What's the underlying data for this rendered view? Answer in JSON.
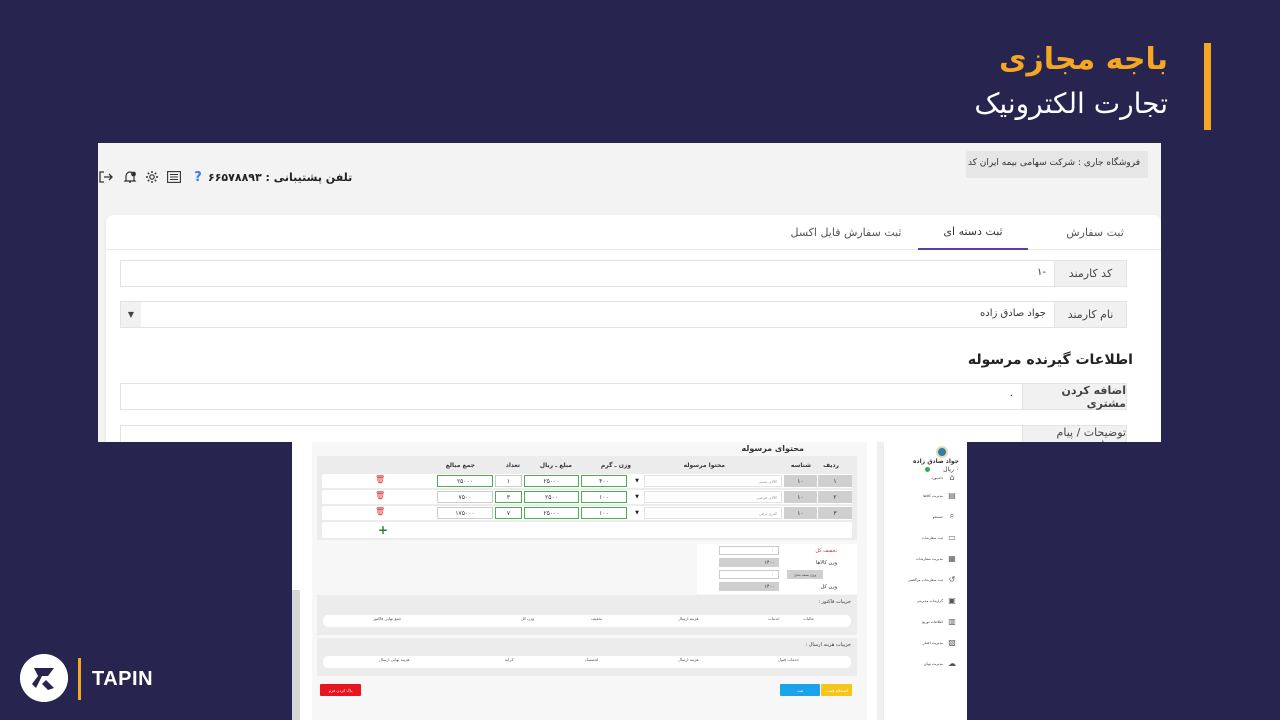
{
  "slide": {
    "title": "باجه مجازی",
    "subtitle": "تجارت الکترونیک",
    "accent_color": "#f5a623",
    "background_color": "#27254f"
  },
  "brand": {
    "name": "TAPIN",
    "logo_icon": "tapin-logo"
  },
  "topbar": {
    "store_label": "فروشگاه جاری : شرکت سهامی بیمه ایران کد۳۱۰۰",
    "support_phone": "تلفن پشتیبانی : ۶۶۵۷۸۸۹۳",
    "icons": [
      "logout-icon",
      "bell-icon",
      "gear-icon",
      "list-icon",
      "help-icon"
    ]
  },
  "tabs": [
    {
      "label": "ثبت سفارش",
      "active": false
    },
    {
      "label": "ثبت دسته ای",
      "active": true
    },
    {
      "label": "ثبت سفارش فایل اکسل",
      "active": false
    }
  ],
  "form": {
    "employee_code_label": "کد کارمند",
    "employee_code_value": "-۱",
    "employee_name_label": "نام کارمند",
    "employee_name_value": "جواد صادق زاده",
    "section_heading": "اطلاعات گیرنده مرسوله",
    "add_customer_label": "اضافه کردن مشتری",
    "add_customer_value": "۰",
    "notes_label": "توضیحات / پیام خریدار"
  },
  "parcel": {
    "title": "محتوای مرسوله",
    "headers": [
      "ردیف",
      "شناسه",
      "محتوا مرسوله",
      "وزن ـ گرم",
      "مبلغ ـ ریال",
      "تعداد",
      "جمع مبالغ"
    ],
    "rows": [
      {
        "index": "۱",
        "id": "۱۰",
        "content": "کالای تستی",
        "weight": "۴۰۰",
        "price": "۲۵۰۰۰",
        "count": "۱",
        "total": "۲۵۰۰۰"
      },
      {
        "index": "۲",
        "id": "۱۰",
        "content": "کالای فرضی",
        "weight": "۱۰۰",
        "price": "۲۵۰۰",
        "count": "۳",
        "total": "۷۵۰۰"
      },
      {
        "index": "۳",
        "id": "۱۰",
        "content": "کتری برقی",
        "weight": "۱۰۰",
        "price": "۲۵۰۰۰",
        "count": "۷",
        "total": "۱۷۵۰۰۰"
      }
    ]
  },
  "summary": {
    "discount_label": "تخفیف کل",
    "discount_value": "۰",
    "goods_weight_label": "وزن کالاها",
    "goods_weight_value": "۱۴۰۰",
    "package_weight_label": "وزن بسته بندی",
    "package_weight_value": "۰",
    "total_weight_label": "وزن کل",
    "total_weight_value": "۱۴۰۰"
  },
  "invoice_details": {
    "title": "جزییات فاکتور :",
    "columns": [
      "مالیات",
      "خدمات",
      "هزینه ارسال",
      "تخفیف",
      "وزن کل",
      "جمع نهایی فاکتور"
    ]
  },
  "shipping_details": {
    "title": "جزییات هزینه ارسال :",
    "columns": [
      "خدمات قبول",
      "هزینه ارسال",
      "لجستیک",
      "کرایه",
      "هزینه نهایی ارسال"
    ]
  },
  "buttons": {
    "inquiry": "استعلام قیمت",
    "submit": "ثبت",
    "reset": "پاک کردن فرم"
  },
  "sidebar": {
    "user_name": "جواد صادق زاده",
    "balance": "۰ ریال",
    "items": [
      {
        "label": "داشبورد",
        "icon": "home-icon"
      },
      {
        "label": "مدیریت کالاها",
        "icon": "box-icon"
      },
      {
        "label": "جستجو",
        "icon": "search-icon"
      },
      {
        "label": "ثبت سفارشات",
        "icon": "cart-icon"
      },
      {
        "label": "مدیریت سفارشات",
        "icon": "truck-icon"
      },
      {
        "label": "ثبت سفارشات مرگشتی",
        "icon": "return-icon"
      },
      {
        "label": "گزارشات مدیریتی",
        "icon": "report-icon"
      },
      {
        "label": "اطلاعات توزیع",
        "icon": "info-icon"
      },
      {
        "label": "مدیریت اعتبار",
        "icon": "wallet-icon"
      },
      {
        "label": "مدیریت توکن",
        "icon": "key-icon"
      }
    ]
  }
}
